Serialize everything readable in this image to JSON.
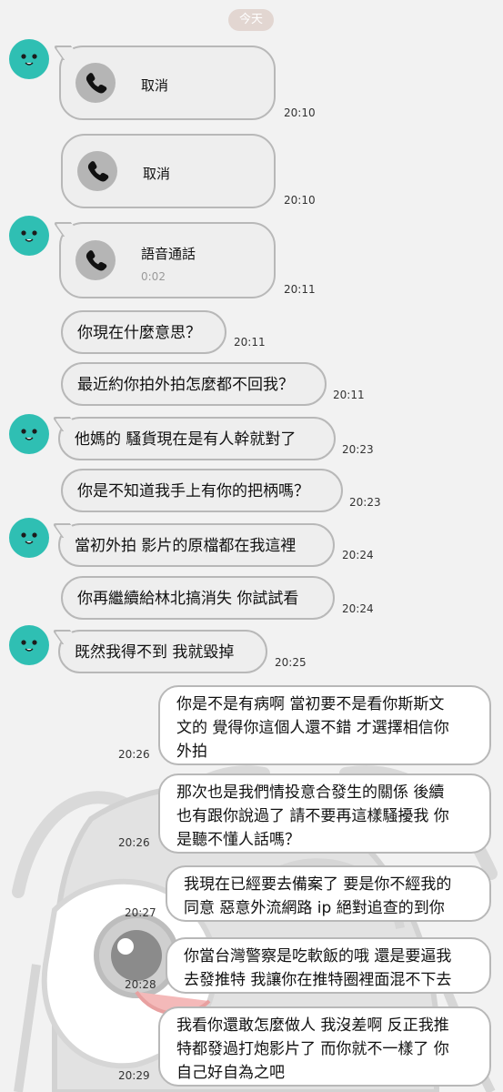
{
  "date_chip": "今天",
  "messages": [
    {
      "type": "call",
      "label": "取消",
      "time": "20:10"
    },
    {
      "type": "call",
      "label": "取消",
      "time": "20:10"
    },
    {
      "type": "call",
      "label": "語音通話",
      "duration": "0:02",
      "time": "20:11"
    },
    {
      "type": "text",
      "text": "你現在什麼意思？",
      "time": "20:11"
    },
    {
      "type": "text",
      "text": "最近約你拍外拍怎麼都不回我？",
      "time": "20:11"
    },
    {
      "type": "text",
      "text": "他媽的 騷貨現在是有人幹就對了",
      "time": "20:23"
    },
    {
      "type": "text",
      "text": "你是不知道我手上有你的把柄嗎？",
      "time": "20:23"
    },
    {
      "type": "text",
      "text": "當初外拍 影片的原檔都在我這裡",
      "time": "20:24"
    },
    {
      "type": "text",
      "text": "你再繼續給林北搞消失 你試試看",
      "time": "20:24"
    },
    {
      "type": "text",
      "text": "既然我得不到 我就毀掉",
      "time": "20:25"
    },
    {
      "type": "text_out",
      "lines": [
        "你是不是有病啊 當初要不是看你斯斯文",
        "文的 覺得你這個人還不錯 才選擇相信你",
        "外拍"
      ],
      "time": "20:26"
    },
    {
      "type": "text_out",
      "lines": [
        "那次也是我們情投意合發生的關係 後續",
        "也有跟你說過了 請不要再這樣騷擾我 你",
        "是聽不懂人話嗎？"
      ],
      "time": "20:26"
    },
    {
      "type": "text_out",
      "lines": [
        "我現在已經要去備案了 要是你不經我的",
        "同意 惡意外流網路 ip 絕對追查的到你"
      ],
      "time": "20:27"
    },
    {
      "type": "text_out",
      "lines": [
        "你當台灣警察是吃軟飯的哦 還是要逼我",
        "去發推特 我讓你在推特圈裡面混不下去"
      ],
      "time": "20:28"
    },
    {
      "type": "text_out",
      "lines": [
        "我看你還敢怎麼做人 我沒差啊 反正我推",
        "特都發過打炮影片了 而你就不一樣了 你",
        "自己好自為之吧"
      ],
      "time": "20:29"
    }
  ],
  "colors": {
    "avatar": "#2fbfb3",
    "bubble_in": "#eeeeee",
    "bubble_out": "#ffffff",
    "border": "#b8b8b8",
    "date_chip": "#e2d6d1"
  },
  "icons": {
    "avatar": "blob-face-avatar",
    "call": "phone-icon"
  }
}
